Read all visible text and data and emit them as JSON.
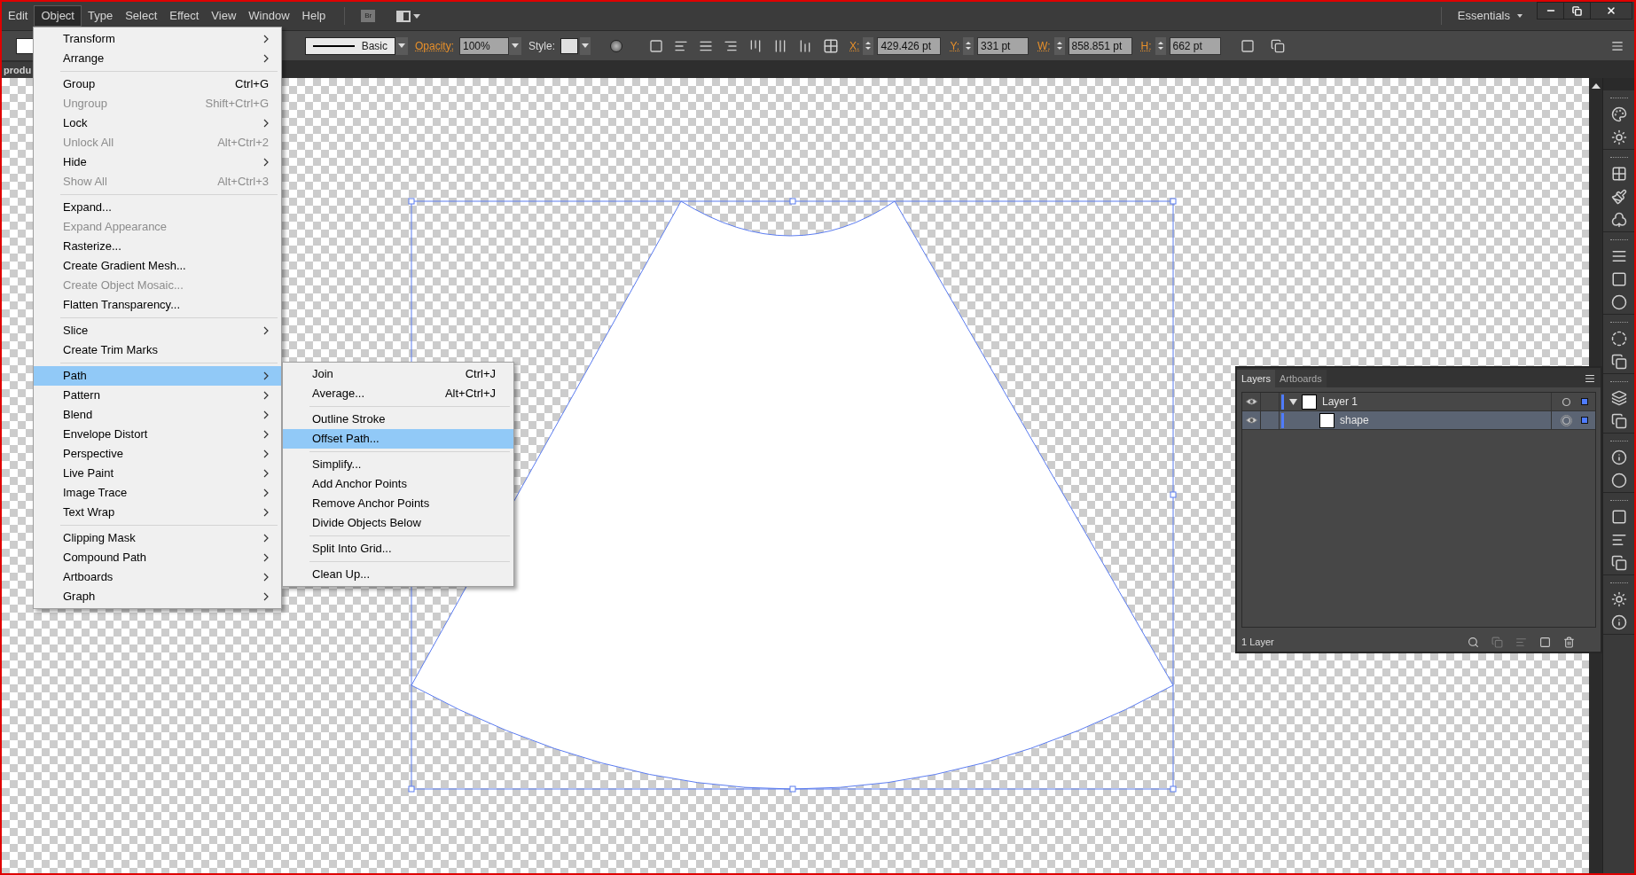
{
  "menu_bar": {
    "items": [
      {
        "label": "Edit",
        "selected": false
      },
      {
        "label": "Object",
        "selected": true
      },
      {
        "label": "Type",
        "selected": false
      },
      {
        "label": "Select",
        "selected": false
      },
      {
        "label": "Effect",
        "selected": false
      },
      {
        "label": "View",
        "selected": false
      },
      {
        "label": "Window",
        "selected": false
      },
      {
        "label": "Help",
        "selected": false
      }
    ],
    "bridge_button": "Br",
    "workspace": "Essentials"
  },
  "control_bar": {
    "stroke_style": "Basic",
    "opacity_label": "Opacity:",
    "opacity": "100%",
    "style_label": "Style:",
    "transform_fields": [
      {
        "label": "X:",
        "value": "429.426 pt"
      },
      {
        "label": "Y:",
        "value": "331 pt"
      },
      {
        "label": "W:",
        "value": "858.851 pt"
      },
      {
        "label": "H:",
        "value": "662 pt"
      }
    ]
  },
  "document_tab": "produ",
  "object_menu": {
    "items": [
      {
        "kind": "item",
        "label": "Transform",
        "submenu": true,
        "disabled": false,
        "selected": false
      },
      {
        "kind": "item",
        "label": "Arrange",
        "submenu": true,
        "disabled": false,
        "selected": false
      },
      {
        "kind": "separator"
      },
      {
        "kind": "item",
        "label": "Group",
        "shortcut": "Ctrl+G",
        "submenu": false,
        "disabled": false,
        "selected": false
      },
      {
        "kind": "item",
        "label": "Ungroup",
        "shortcut": "Shift+Ctrl+G",
        "submenu": false,
        "disabled": true,
        "selected": false
      },
      {
        "kind": "item",
        "label": "Lock",
        "submenu": true,
        "disabled": false,
        "selected": false
      },
      {
        "kind": "item",
        "label": "Unlock All",
        "shortcut": "Alt+Ctrl+2",
        "submenu": false,
        "disabled": true,
        "selected": false
      },
      {
        "kind": "item",
        "label": "Hide",
        "submenu": true,
        "disabled": false,
        "selected": false
      },
      {
        "kind": "item",
        "label": "Show All",
        "shortcut": "Alt+Ctrl+3",
        "submenu": false,
        "disabled": true,
        "selected": false
      },
      {
        "kind": "separator"
      },
      {
        "kind": "item",
        "label": "Expand...",
        "submenu": false,
        "disabled": false,
        "selected": false
      },
      {
        "kind": "item",
        "label": "Expand Appearance",
        "submenu": false,
        "disabled": true,
        "selected": false
      },
      {
        "kind": "item",
        "label": "Rasterize...",
        "submenu": false,
        "disabled": false,
        "selected": false
      },
      {
        "kind": "item",
        "label": "Create Gradient Mesh...",
        "submenu": false,
        "disabled": false,
        "selected": false
      },
      {
        "kind": "item",
        "label": "Create Object Mosaic...",
        "submenu": false,
        "disabled": true,
        "selected": false
      },
      {
        "kind": "item",
        "label": "Flatten Transparency...",
        "submenu": false,
        "disabled": false,
        "selected": false
      },
      {
        "kind": "separator"
      },
      {
        "kind": "item",
        "label": "Slice",
        "submenu": true,
        "disabled": false,
        "selected": false
      },
      {
        "kind": "item",
        "label": "Create Trim Marks",
        "submenu": false,
        "disabled": false,
        "selected": false
      },
      {
        "kind": "separator"
      },
      {
        "kind": "item",
        "label": "Path",
        "submenu": true,
        "disabled": false,
        "selected": true
      },
      {
        "kind": "item",
        "label": "Pattern",
        "submenu": true,
        "disabled": false,
        "selected": false
      },
      {
        "kind": "item",
        "label": "Blend",
        "submenu": true,
        "disabled": false,
        "selected": false
      },
      {
        "kind": "item",
        "label": "Envelope Distort",
        "submenu": true,
        "disabled": false,
        "selected": false
      },
      {
        "kind": "item",
        "label": "Perspective",
        "submenu": true,
        "disabled": false,
        "selected": false
      },
      {
        "kind": "item",
        "label": "Live Paint",
        "submenu": true,
        "disabled": false,
        "selected": false
      },
      {
        "kind": "item",
        "label": "Image Trace",
        "submenu": true,
        "disabled": false,
        "selected": false
      },
      {
        "kind": "item",
        "label": "Text Wrap",
        "submenu": true,
        "disabled": false,
        "selected": false
      },
      {
        "kind": "separator"
      },
      {
        "kind": "item",
        "label": "Clipping Mask",
        "submenu": true,
        "disabled": false,
        "selected": false
      },
      {
        "kind": "item",
        "label": "Compound Path",
        "submenu": true,
        "disabled": false,
        "selected": false
      },
      {
        "kind": "item",
        "label": "Artboards",
        "submenu": true,
        "disabled": false,
        "selected": false
      },
      {
        "kind": "item",
        "label": "Graph",
        "submenu": true,
        "disabled": false,
        "selected": false
      }
    ]
  },
  "path_submenu": {
    "items": [
      {
        "kind": "item",
        "label": "Join",
        "shortcut": "Ctrl+J",
        "submenu": false,
        "disabled": false,
        "selected": false
      },
      {
        "kind": "item",
        "label": "Average...",
        "shortcut": "Alt+Ctrl+J",
        "submenu": false,
        "disabled": false,
        "selected": false
      },
      {
        "kind": "separator"
      },
      {
        "kind": "item",
        "label": "Outline Stroke",
        "submenu": false,
        "disabled": false,
        "selected": false
      },
      {
        "kind": "item",
        "label": "Offset Path...",
        "submenu": false,
        "disabled": false,
        "selected": true
      },
      {
        "kind": "separator"
      },
      {
        "kind": "item",
        "label": "Simplify...",
        "submenu": false,
        "disabled": false,
        "selected": false
      },
      {
        "kind": "item",
        "label": "Add Anchor Points",
        "submenu": false,
        "disabled": false,
        "selected": false
      },
      {
        "kind": "item",
        "label": "Remove Anchor Points",
        "submenu": false,
        "disabled": false,
        "selected": false
      },
      {
        "kind": "item",
        "label": "Divide Objects Below",
        "submenu": false,
        "disabled": false,
        "selected": false
      },
      {
        "kind": "separator"
      },
      {
        "kind": "item",
        "label": "Split Into Grid...",
        "submenu": false,
        "disabled": false,
        "selected": false
      },
      {
        "kind": "separator"
      },
      {
        "kind": "item",
        "label": "Clean Up...",
        "submenu": false,
        "disabled": false,
        "selected": false
      }
    ]
  },
  "layers_panel": {
    "tabs": [
      {
        "label": "Layers",
        "selected": true
      },
      {
        "label": "Artboards",
        "selected": false
      }
    ],
    "layers": [
      {
        "name": "Layer 1",
        "selected": false,
        "expanded": true,
        "children": [
          {
            "name": "shape",
            "selected": true
          }
        ]
      }
    ],
    "footer": "1 Layer"
  }
}
